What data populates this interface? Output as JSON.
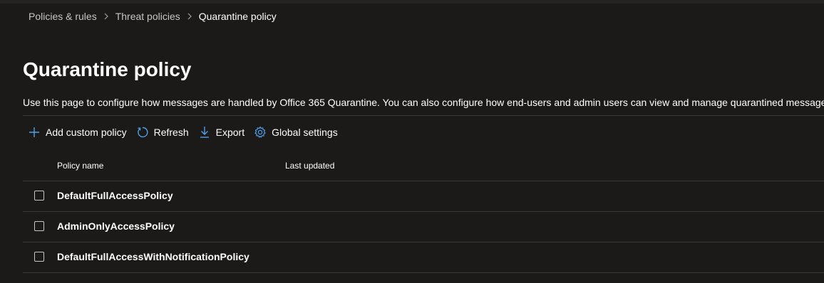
{
  "breadcrumb": {
    "items": [
      "Policies & rules",
      "Threat policies",
      "Quarantine policy"
    ]
  },
  "page": {
    "title": "Quarantine policy",
    "description": "Use this page to configure how messages are handled by Office 365 Quarantine. You can also configure how end-users and admin users can view and manage quarantined messages."
  },
  "toolbar": {
    "add_label": "Add custom policy",
    "refresh_label": "Refresh",
    "export_label": "Export",
    "global_label": "Global settings",
    "add_icon": "plus-icon",
    "refresh_icon": "refresh-icon",
    "export_icon": "download-icon",
    "global_icon": "gear-icon"
  },
  "table": {
    "columns": [
      "Policy name",
      "Last updated"
    ],
    "rows": [
      {
        "name": "DefaultFullAccessPolicy",
        "last_updated": ""
      },
      {
        "name": "AdminOnlyAccessPolicy",
        "last_updated": ""
      },
      {
        "name": "DefaultFullAccessWithNotificationPolicy",
        "last_updated": ""
      }
    ]
  },
  "colors": {
    "background": "#1b1a19",
    "accent": "#4f9fe6",
    "divider": "#3b3a39"
  }
}
